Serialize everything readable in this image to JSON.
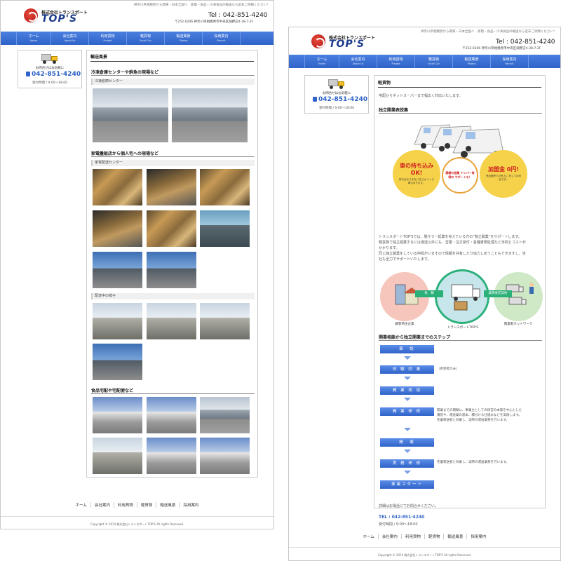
{
  "site": {
    "tagline": "神奈川県相模原から関東・日本全国へ　家電・食品・冷凍食品の輸送なら是非ご依頼ください！",
    "logo_company": "株式会社トランスポート",
    "logo_brand": "TOP'S",
    "tel": "Tel : 042-851-4240",
    "address": "〒252-0206 神奈川県相模原市中央区淵野辺4-38-7-2F"
  },
  "nav": [
    {
      "jp": "ホーム",
      "en": "Home"
    },
    {
      "jp": "会社案内",
      "en": "About Us"
    },
    {
      "jp": "利用貨物",
      "en": "Freight"
    },
    {
      "jp": "軽貨物",
      "en": "Small Car"
    },
    {
      "jp": "輸送風景",
      "en": "Photos"
    },
    {
      "jp": "採用案内",
      "en": "Recruit"
    }
  ],
  "sidebar": {
    "label": "お問合せはお気軽に",
    "tel": "042-851-4240",
    "hours": "受付時間 / 9:00～18:00"
  },
  "left_page": {
    "title": "輸送風景",
    "sections": [
      {
        "heading": "冷凍倉庫センターや鮮魚の現場など",
        "sub": "冷凍倉庫センター"
      },
      {
        "heading": "家電量販店から個人宅への現場など",
        "sub": "家電配送センター"
      },
      {
        "heading": "",
        "sub": "配達中の様子"
      },
      {
        "heading": "食品宅配や宅配便など",
        "sub": ""
      }
    ]
  },
  "right_page": {
    "title": "軽貨物",
    "intro": "宅配からネットスーパーまで幅広く対応いたします。",
    "section1": "独立開業表説集",
    "promo": {
      "left_big": "車の持ち込み OK!",
      "left_small": "持ち込みできない方には リース車もあります。",
      "center": "黒棚の営業 ナンバー取得の サポートも！",
      "right_big": "加盟金 0円!",
      "right_small": "売出発売での売上に 対しての歩合です。"
    },
    "desc_lines": [
      "トランスポートTOP'Sでは、脱サラ・起業を考えている方の”独立開業”をサポートします。",
      "軽貨物で独立開業するには運送以外にも、営業・注文受付・各種書類処理など手間とコストが",
      "かかります。",
      "同じ独立開業をしている仲間がいますので情報を共有したり協力しあうこともできますし、当",
      "社も全力でサポートいたします。"
    ],
    "diagram": {
      "left_label": "顧客荷主企業",
      "center_label": "トランスポートTOP'S",
      "right_label": "開業者ネットワーク",
      "arrow1": "依　頼",
      "arrow2": "業務委託契約"
    },
    "section2": "開業相談から独立開業までのステップ",
    "steps": [
      {
        "label": "面　談",
        "note": ""
      },
      {
        "label": "体 験 同 乗",
        "note": "（希望者のみ）"
      },
      {
        "label": "開 業 相 談",
        "note": ""
      },
      {
        "label": "開 業 研 修",
        "note": "開業までの期間に、事業主としての経営の本質を中心とした\n講習や、運送業の基本、積付ける仕組みなどを実践します。\n先輩運送者と同乗し、実際の運送業務を行います。"
      },
      {
        "label": "開　業",
        "note": ""
      },
      {
        "label": "実 務 研 修",
        "note": "先輩運送者と同乗し、実際の運送業務を行います。"
      },
      {
        "label": "事業スタート",
        "note": ""
      }
    ],
    "contact_note": "詳細はお電話にてお問合せください。",
    "contact_tel": "TEL : 042-851-4240",
    "contact_hours": "受付時間 / 9:00～18:00"
  },
  "footer": {
    "links": [
      "ホーム",
      "会社案内",
      "利用貨物",
      "軽貨物",
      "輸送風景",
      "採用案内"
    ],
    "copyright": "Copyright © 2014 株式会社トランスポートTOP'S All rights Reserved."
  },
  "colors": {
    "nav": "#2f63c8",
    "accent_red": "#d02020",
    "accent_orange": "#f08a00"
  }
}
